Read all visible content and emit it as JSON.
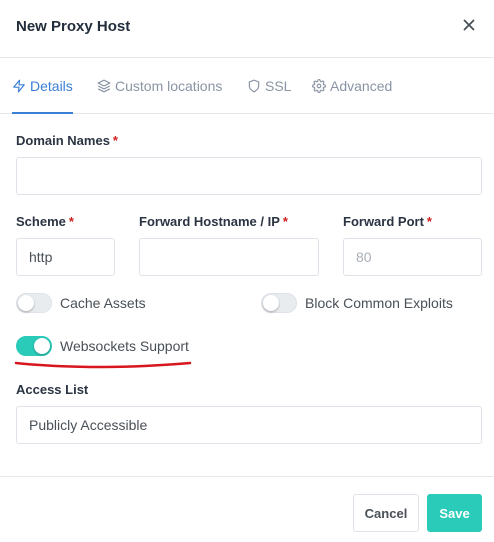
{
  "dialog": {
    "title": "New Proxy Host"
  },
  "tabs": [
    {
      "label": "Details",
      "icon": "zap-icon",
      "active": true
    },
    {
      "label": "Custom locations",
      "icon": "layers-icon",
      "active": false
    },
    {
      "label": "SSL",
      "icon": "shield-icon",
      "active": false
    },
    {
      "label": "Advanced",
      "icon": "gear-icon",
      "active": false
    }
  ],
  "form": {
    "domain_names": {
      "label": "Domain Names",
      "required": "*",
      "value": ""
    },
    "scheme": {
      "label": "Scheme",
      "required": "*",
      "value": "http"
    },
    "forward_host": {
      "label": "Forward Hostname / IP",
      "required": "*",
      "value": ""
    },
    "forward_port": {
      "label": "Forward Port",
      "required": "*",
      "value": "",
      "placeholder": "80"
    },
    "cache_assets": {
      "label": "Cache Assets",
      "checked": false
    },
    "block_exploits": {
      "label": "Block Common Exploits",
      "checked": false
    },
    "websockets": {
      "label": "Websockets Support",
      "checked": true
    },
    "access_list": {
      "label": "Access List",
      "value": "Publicly Accessible"
    }
  },
  "footer": {
    "cancel_label": "Cancel",
    "save_label": "Save"
  },
  "colors": {
    "accent": "#3a7fd5",
    "toggle_on": "#2bcbba",
    "required": "#cd201f",
    "annotation": "#d8161d"
  }
}
